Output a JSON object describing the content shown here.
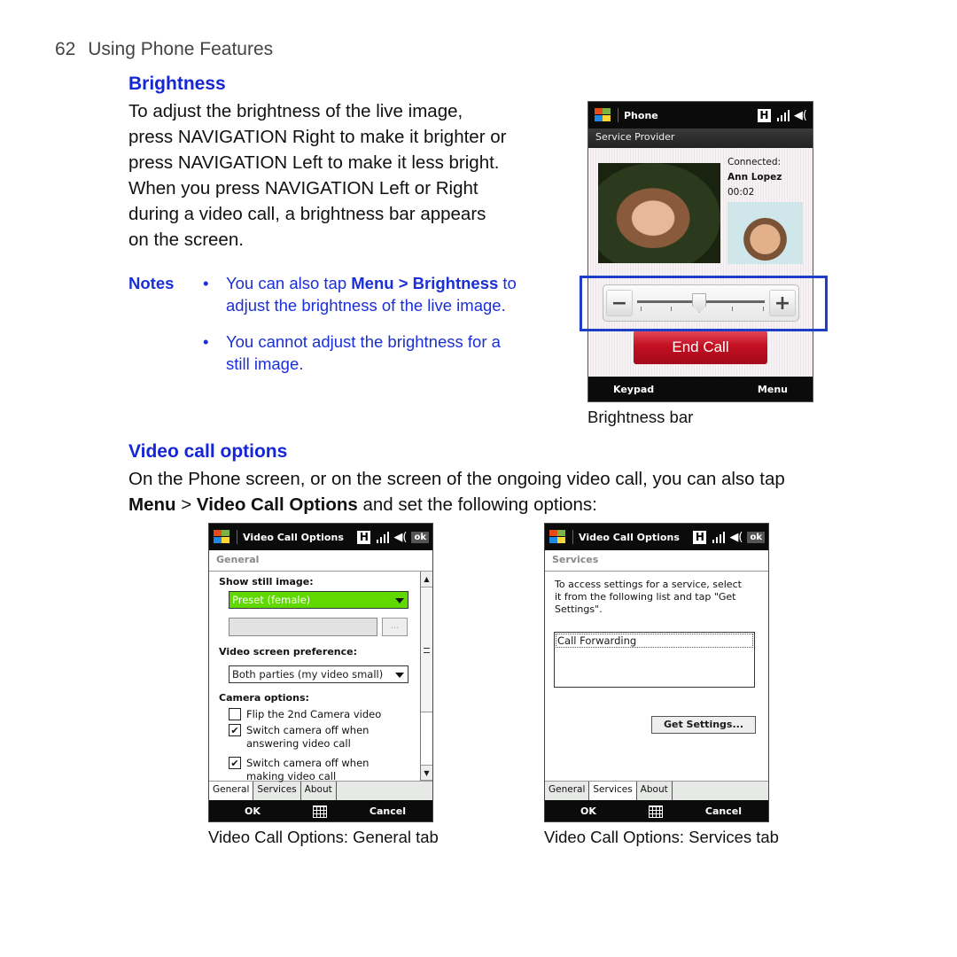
{
  "page": {
    "number": "62",
    "section_title": "Using Phone Features"
  },
  "brightness": {
    "heading": "Brightness",
    "paragraph_lines": [
      "To adjust the brightness of the live image,",
      "press NAVIGATION Right to make it brighter or",
      "press NAVIGATION Left to make it less bright.",
      "When you press NAVIGATION Left or Right",
      "during a video call, a brightness bar appears",
      "on the screen."
    ],
    "notes_label": "Notes",
    "note1_pre": "You can also tap ",
    "note1_bold": "Menu > Brightness",
    "note1_post": " to",
    "note1_line2": "adjust the brightness of the live image.",
    "note2_line1": "You cannot adjust the brightness for a",
    "note2_line2": "still image.",
    "bullet": "•"
  },
  "phone_screen": {
    "title": "Phone",
    "subtitle": "Service Provider",
    "connected_label": "Connected:",
    "caller_name": "Ann Lopez",
    "call_duration": "00:02",
    "status_icons": [
      "h-network-icon",
      "signal-icon",
      "volume-icon"
    ],
    "h_icon_text": "H",
    "volume_icon_text": "◀(",
    "brightness_minus": "−",
    "brightness_plus": "+",
    "brightness_level": 0.48,
    "end_call_label": "End Call",
    "softkey_left": "Keypad",
    "softkey_right": "Menu",
    "caption": "Brightness bar",
    "accent_highlight_color": "#1e3ec8",
    "end_call_color": "#c21022"
  },
  "video_call_options": {
    "heading": "Video call options",
    "intro_line1": "On the Phone screen, or on the screen of the ongoing video call, you can also tap",
    "intro_menu": "Menu",
    "intro_sep": " > ",
    "intro_bold": "Video Call Options",
    "intro_post": " and set the following options:"
  },
  "general_screen": {
    "title": "Video Call Options",
    "ok_label": "ok",
    "subtitle": "General",
    "show_still_label": "Show still image:",
    "still_image_value": "Preset (female)",
    "browse_button": "...",
    "video_pref_label": "Video screen preference:",
    "video_pref_value": "Both parties (my video small)",
    "camera_options_label": "Camera options:",
    "checkboxes": [
      {
        "label_line1": "Flip the 2nd Camera video",
        "label_line2": "",
        "checked": false
      },
      {
        "label_line1": "Switch camera off when",
        "label_line2": "answering video call",
        "checked": true
      },
      {
        "label_line1": "Switch camera off when",
        "label_line2": "making video call",
        "checked": true
      }
    ],
    "check_mark": "✔",
    "tabs": [
      "General",
      "Services",
      "About"
    ],
    "active_tab": "General",
    "softkey_ok": "OK",
    "softkey_cancel": "Cancel",
    "caption": "Video Call Options: General tab",
    "selected_color": "#5fd900"
  },
  "services_screen": {
    "title": "Video Call Options",
    "ok_label": "ok",
    "subtitle": "Services",
    "instructions": "To access settings for a service, select it from the following list and tap \"Get Settings\".",
    "list_items": [
      "Call Forwarding"
    ],
    "get_settings_button": "Get Settings...",
    "tabs": [
      "General",
      "Services",
      "About"
    ],
    "active_tab": "Services",
    "softkey_ok": "OK",
    "softkey_cancel": "Cancel",
    "caption": "Video Call Options: Services tab"
  }
}
